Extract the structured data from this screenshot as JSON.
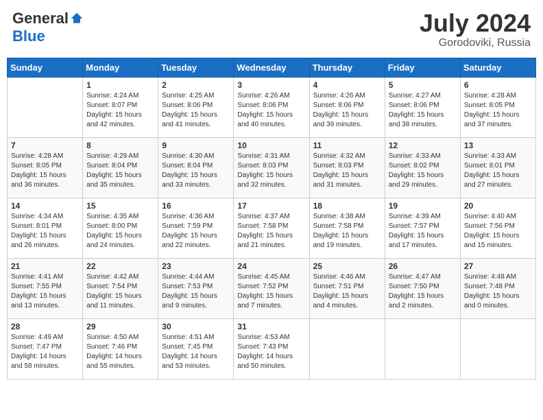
{
  "header": {
    "logo_general": "General",
    "logo_blue": "Blue",
    "month_year": "July 2024",
    "location": "Gorodoviki, Russia"
  },
  "days_of_week": [
    "Sunday",
    "Monday",
    "Tuesday",
    "Wednesday",
    "Thursday",
    "Friday",
    "Saturday"
  ],
  "weeks": [
    [
      {
        "day": "",
        "info": ""
      },
      {
        "day": "1",
        "info": "Sunrise: 4:24 AM\nSunset: 8:07 PM\nDaylight: 15 hours\nand 42 minutes."
      },
      {
        "day": "2",
        "info": "Sunrise: 4:25 AM\nSunset: 8:06 PM\nDaylight: 15 hours\nand 41 minutes."
      },
      {
        "day": "3",
        "info": "Sunrise: 4:26 AM\nSunset: 8:06 PM\nDaylight: 15 hours\nand 40 minutes."
      },
      {
        "day": "4",
        "info": "Sunrise: 4:26 AM\nSunset: 8:06 PM\nDaylight: 15 hours\nand 39 minutes."
      },
      {
        "day": "5",
        "info": "Sunrise: 4:27 AM\nSunset: 8:06 PM\nDaylight: 15 hours\nand 38 minutes."
      },
      {
        "day": "6",
        "info": "Sunrise: 4:28 AM\nSunset: 8:05 PM\nDaylight: 15 hours\nand 37 minutes."
      }
    ],
    [
      {
        "day": "7",
        "info": "Sunrise: 4:28 AM\nSunset: 8:05 PM\nDaylight: 15 hours\nand 36 minutes."
      },
      {
        "day": "8",
        "info": "Sunrise: 4:29 AM\nSunset: 8:04 PM\nDaylight: 15 hours\nand 35 minutes."
      },
      {
        "day": "9",
        "info": "Sunrise: 4:30 AM\nSunset: 8:04 PM\nDaylight: 15 hours\nand 33 minutes."
      },
      {
        "day": "10",
        "info": "Sunrise: 4:31 AM\nSunset: 8:03 PM\nDaylight: 15 hours\nand 32 minutes."
      },
      {
        "day": "11",
        "info": "Sunrise: 4:32 AM\nSunset: 8:03 PM\nDaylight: 15 hours\nand 31 minutes."
      },
      {
        "day": "12",
        "info": "Sunrise: 4:33 AM\nSunset: 8:02 PM\nDaylight: 15 hours\nand 29 minutes."
      },
      {
        "day": "13",
        "info": "Sunrise: 4:33 AM\nSunset: 8:01 PM\nDaylight: 15 hours\nand 27 minutes."
      }
    ],
    [
      {
        "day": "14",
        "info": "Sunrise: 4:34 AM\nSunset: 8:01 PM\nDaylight: 15 hours\nand 26 minutes."
      },
      {
        "day": "15",
        "info": "Sunrise: 4:35 AM\nSunset: 8:00 PM\nDaylight: 15 hours\nand 24 minutes."
      },
      {
        "day": "16",
        "info": "Sunrise: 4:36 AM\nSunset: 7:59 PM\nDaylight: 15 hours\nand 22 minutes."
      },
      {
        "day": "17",
        "info": "Sunrise: 4:37 AM\nSunset: 7:58 PM\nDaylight: 15 hours\nand 21 minutes."
      },
      {
        "day": "18",
        "info": "Sunrise: 4:38 AM\nSunset: 7:58 PM\nDaylight: 15 hours\nand 19 minutes."
      },
      {
        "day": "19",
        "info": "Sunrise: 4:39 AM\nSunset: 7:57 PM\nDaylight: 15 hours\nand 17 minutes."
      },
      {
        "day": "20",
        "info": "Sunrise: 4:40 AM\nSunset: 7:56 PM\nDaylight: 15 hours\nand 15 minutes."
      }
    ],
    [
      {
        "day": "21",
        "info": "Sunrise: 4:41 AM\nSunset: 7:55 PM\nDaylight: 15 hours\nand 13 minutes."
      },
      {
        "day": "22",
        "info": "Sunrise: 4:42 AM\nSunset: 7:54 PM\nDaylight: 15 hours\nand 11 minutes."
      },
      {
        "day": "23",
        "info": "Sunrise: 4:44 AM\nSunset: 7:53 PM\nDaylight: 15 hours\nand 9 minutes."
      },
      {
        "day": "24",
        "info": "Sunrise: 4:45 AM\nSunset: 7:52 PM\nDaylight: 15 hours\nand 7 minutes."
      },
      {
        "day": "25",
        "info": "Sunrise: 4:46 AM\nSunset: 7:51 PM\nDaylight: 15 hours\nand 4 minutes."
      },
      {
        "day": "26",
        "info": "Sunrise: 4:47 AM\nSunset: 7:50 PM\nDaylight: 15 hours\nand 2 minutes."
      },
      {
        "day": "27",
        "info": "Sunrise: 4:48 AM\nSunset: 7:48 PM\nDaylight: 15 hours\nand 0 minutes."
      }
    ],
    [
      {
        "day": "28",
        "info": "Sunrise: 4:49 AM\nSunset: 7:47 PM\nDaylight: 14 hours\nand 58 minutes."
      },
      {
        "day": "29",
        "info": "Sunrise: 4:50 AM\nSunset: 7:46 PM\nDaylight: 14 hours\nand 55 minutes."
      },
      {
        "day": "30",
        "info": "Sunrise: 4:51 AM\nSunset: 7:45 PM\nDaylight: 14 hours\nand 53 minutes."
      },
      {
        "day": "31",
        "info": "Sunrise: 4:53 AM\nSunset: 7:43 PM\nDaylight: 14 hours\nand 50 minutes."
      },
      {
        "day": "",
        "info": ""
      },
      {
        "day": "",
        "info": ""
      },
      {
        "day": "",
        "info": ""
      }
    ]
  ]
}
